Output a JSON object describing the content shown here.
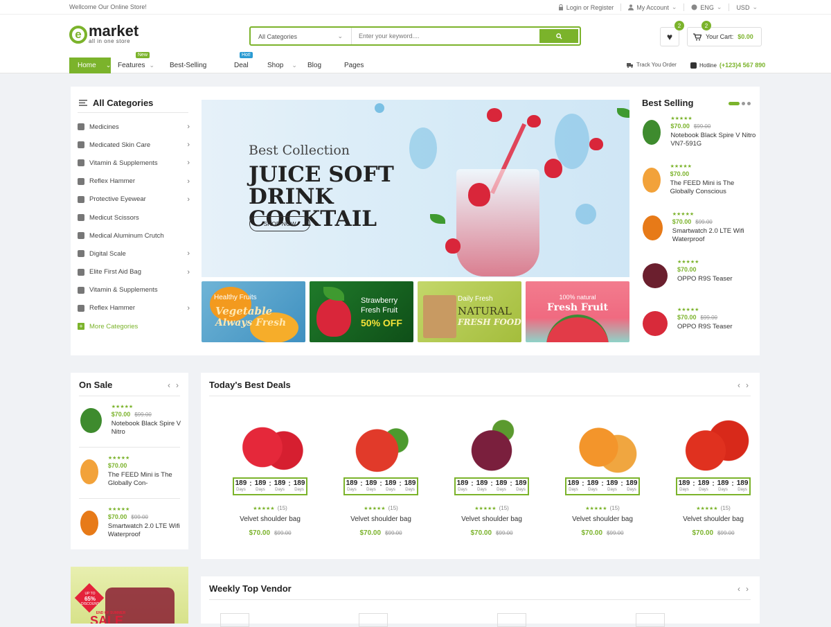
{
  "topbar": {
    "welcome": "Wellcome Our Online Store!",
    "login": "Login or Register",
    "account": "My Account",
    "language": "ENG",
    "currency": "USD"
  },
  "header": {
    "logo_word": "market",
    "logo_tagline": "all in one store",
    "search_category": "All Categories",
    "search_placeholder": "Enter your keyword....",
    "wishlist_count": "2",
    "cart_count": "2",
    "cart_label": "Your Cart:",
    "cart_total": "$0.00"
  },
  "nav": {
    "home": "Home",
    "features": "Features",
    "features_flag": "New",
    "best_selling": "Best-Selling",
    "deal": "Deal",
    "deal_flag": "Hot!",
    "shop": "Shop",
    "blog": "Blog",
    "pages": "Pages",
    "track": "Track You Order",
    "hotline_label": "Hotline",
    "hotline_number": "(+123)4 567 890"
  },
  "categories": {
    "title": "All Categories",
    "items": [
      {
        "label": "Medicines",
        "has_sub": true
      },
      {
        "label": "Medicated Skin Care",
        "has_sub": true
      },
      {
        "label": "Vitamin & Supplements",
        "has_sub": true
      },
      {
        "label": "Reflex Hammer",
        "has_sub": true
      },
      {
        "label": "Protective Eyewear",
        "has_sub": true
      },
      {
        "label": "Medicut Scissors",
        "has_sub": false
      },
      {
        "label": "Medical Aluminum Crutch",
        "has_sub": false
      },
      {
        "label": "Digital Scale",
        "has_sub": true
      },
      {
        "label": "Elite First Aid Bag",
        "has_sub": true
      },
      {
        "label": "Vitamin & Supplements",
        "has_sub": false
      },
      {
        "label": "Reflex Hammer",
        "has_sub": true
      }
    ],
    "more": "More Categories"
  },
  "banner": {
    "subtitle": "Best Collection",
    "title_line1": "JUICE SOFT DRINK",
    "title_line2": "COCKTAIL",
    "button": "SHOP NOW"
  },
  "mini_banners": [
    {
      "line1": "Healthy Fruits",
      "line2": "Vegetable",
      "line3": "Always Fresh"
    },
    {
      "line1": "Strawberry",
      "line2": "Fresh Fruit",
      "line3": "50% OFF"
    },
    {
      "line1": "Daily Fresh",
      "line2": "NATURAL",
      "line3": "FRESH FOOD"
    },
    {
      "line1": "100% natural",
      "line2": "Fresh Fruit",
      "line3": ""
    }
  ],
  "best_selling": {
    "title": "Best Selling",
    "items": [
      {
        "price": "$70.00",
        "old_price": "$99.00",
        "name": "Notebook Black Spire V Nitro VN7-591G"
      },
      {
        "price": "$70.00",
        "old_price": "",
        "name": "The FEED Mini is The Globally Conscious"
      },
      {
        "price": "$70.00",
        "old_price": "$99.00",
        "name": "Smartwatch 2.0 LTE Wifi Waterproof"
      },
      {
        "price": "$70.00",
        "old_price": "",
        "name": "OPPO R9S Teaser"
      },
      {
        "price": "$70.00",
        "old_price": "$99.00",
        "name": "OPPO R9S Teaser"
      }
    ]
  },
  "on_sale": {
    "title": "On Sale",
    "items": [
      {
        "price": "$70.00",
        "old_price": "$99.00",
        "name": "Notebook Black Spire V Nitro"
      },
      {
        "price": "$70.00",
        "old_price": "",
        "name": "The FEED Mini is The Globally Con-"
      },
      {
        "price": "$70.00",
        "old_price": "$99.00",
        "name": "Smartwatch 2.0 LTE Wifi Waterproof"
      }
    ]
  },
  "deals": {
    "title": "Today's Best Deals",
    "countdown_labels": [
      "Days",
      "Days",
      "Days",
      "Days"
    ],
    "items": [
      {
        "fruit": "strawberry",
        "countdown": [
          "189",
          "189",
          "189",
          "189"
        ],
        "reviews": "(15)",
        "name": "Velvet shoulder bag",
        "price": "$70.00",
        "old_price": "$99.00"
      },
      {
        "fruit": "peach",
        "countdown": [
          "189",
          "189",
          "189",
          "189"
        ],
        "reviews": "(15)",
        "name": "Velvet shoulder bag",
        "price": "$70.00",
        "old_price": "$99.00"
      },
      {
        "fruit": "grapes",
        "countdown": [
          "189",
          "189",
          "189",
          "189"
        ],
        "reviews": "(15)",
        "name": "Velvet shoulder bag",
        "price": "$70.00",
        "old_price": "$99.00"
      },
      {
        "fruit": "apricot",
        "countdown": [
          "189",
          "189",
          "189",
          "189"
        ],
        "reviews": "(15)",
        "name": "Velvet shoulder bag",
        "price": "$70.00",
        "old_price": "$99.00"
      },
      {
        "fruit": "tomato",
        "countdown": [
          "189",
          "189",
          "189",
          "189"
        ],
        "reviews": "(15)",
        "name": "Velvet shoulder bag",
        "price": "$70.00",
        "old_price": "$99.00"
      }
    ]
  },
  "promo": {
    "discount_top": "UP TO",
    "discount": "65%",
    "discount_bottom": "DISCOUNT",
    "strip": "END OF SUMMER",
    "big": "SALE"
  },
  "vendor": {
    "title": "Weekly Top Vendor"
  },
  "colors": {
    "accent": "#7bb32b",
    "text": "#333333",
    "background": "#f0f2f5"
  }
}
